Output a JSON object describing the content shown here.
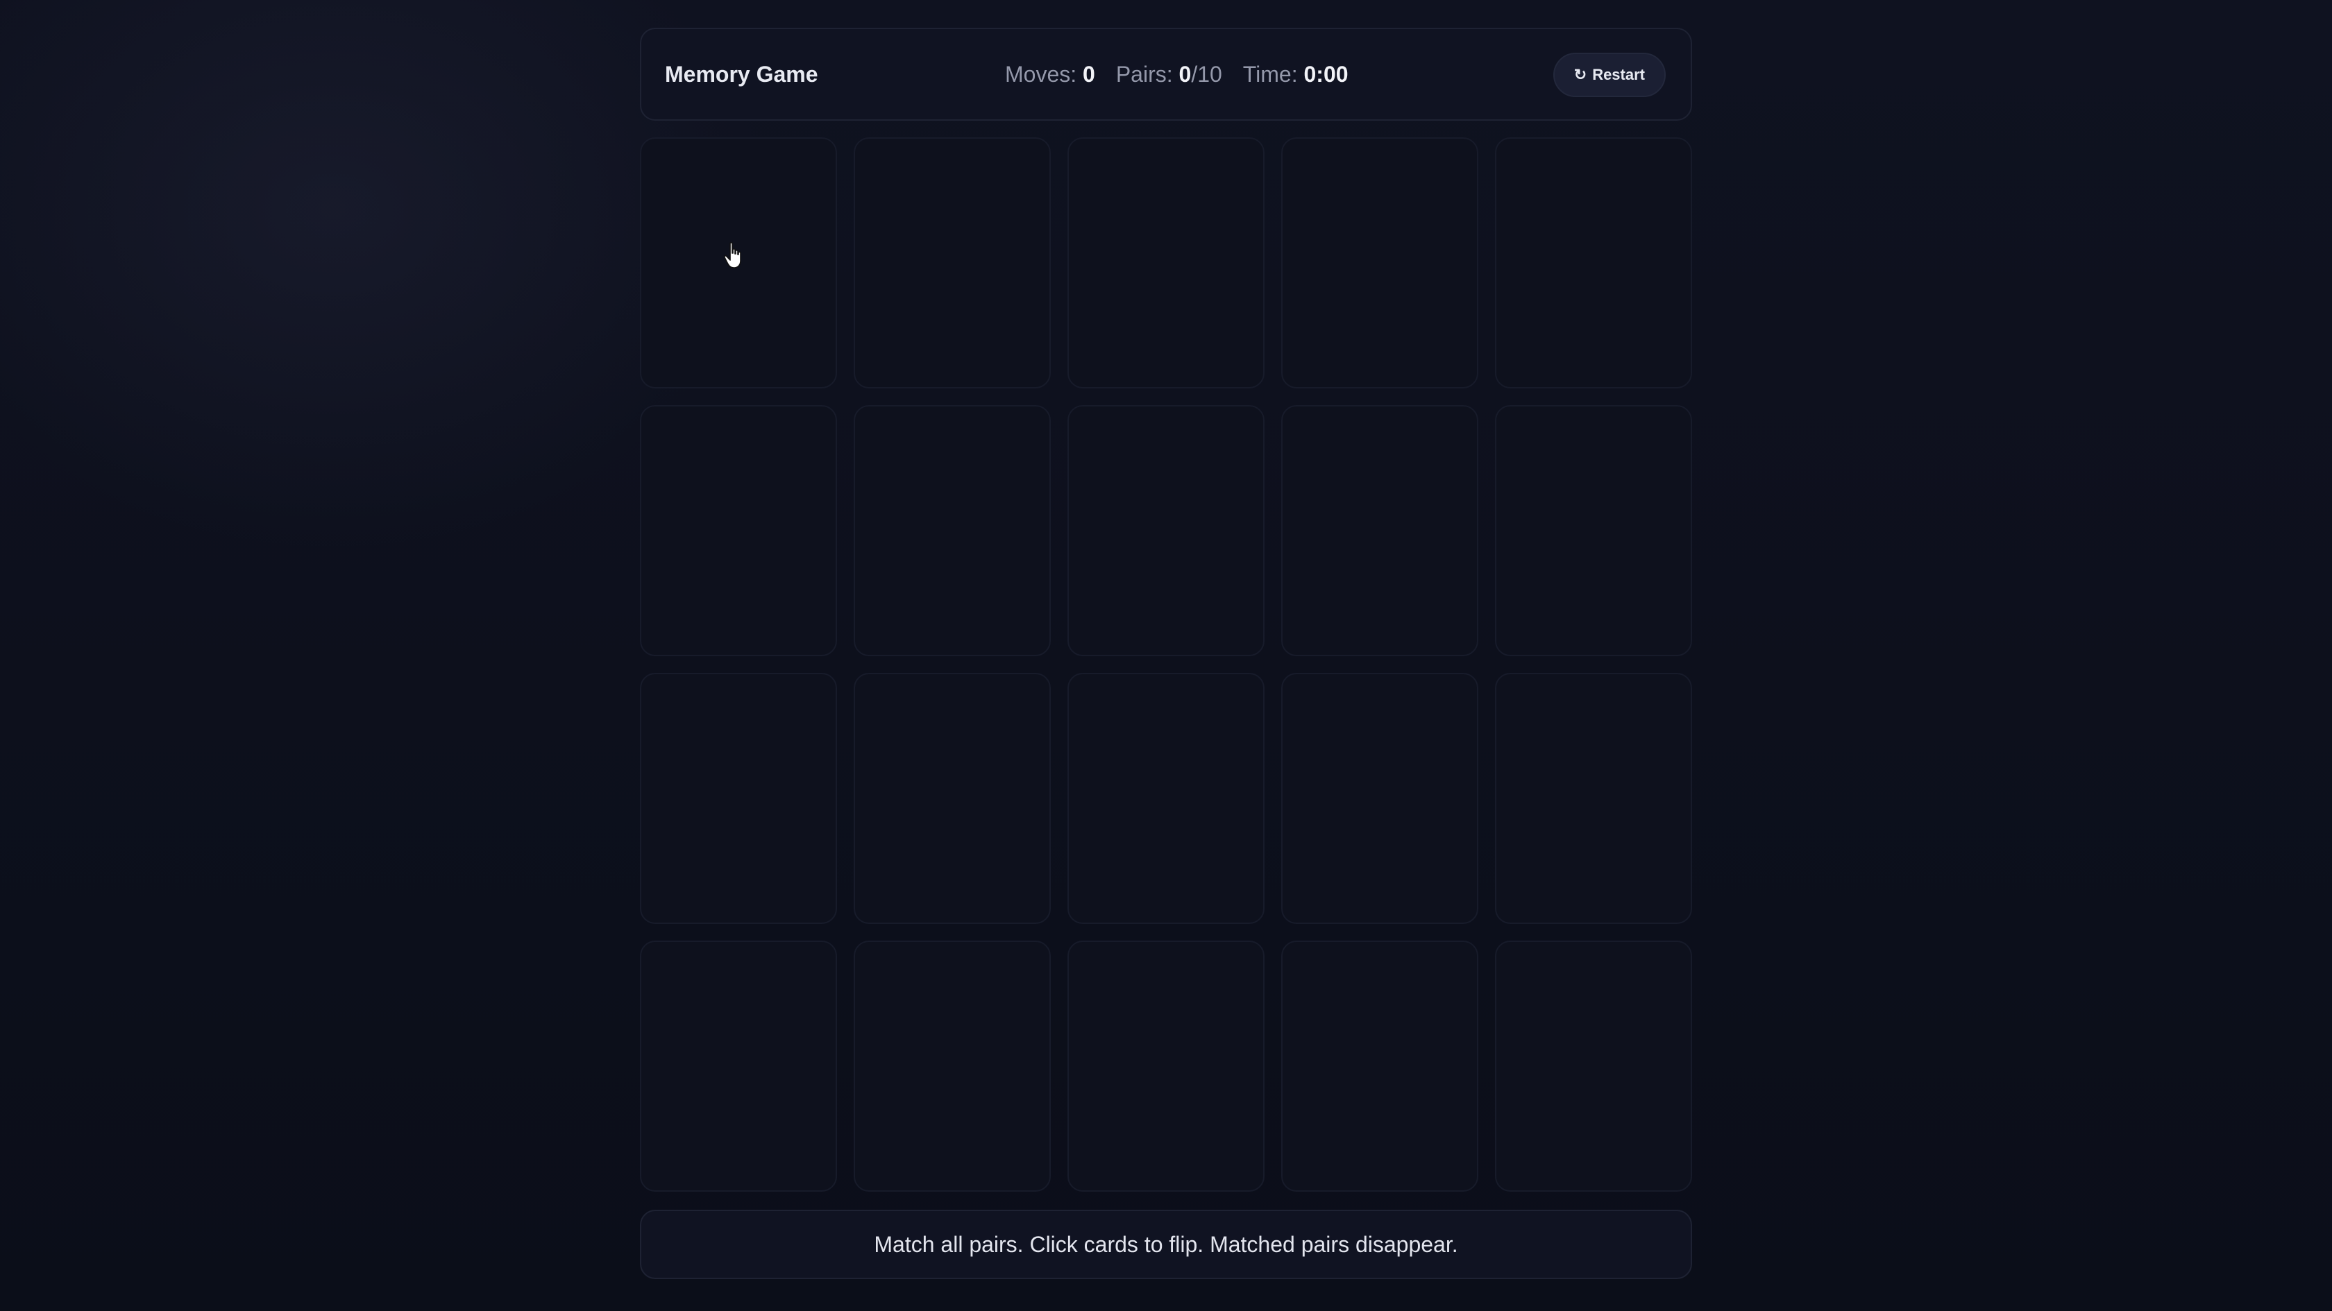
{
  "header": {
    "title": "Memory Game",
    "moves_label": "Moves:",
    "moves_value": "0",
    "pairs_label": "Pairs:",
    "pairs_value": "0",
    "pairs_total": "/10",
    "time_label": "Time:",
    "time_value": "0:00",
    "restart_label": "Restart",
    "restart_icon": "refresh-icon"
  },
  "board": {
    "rows": 4,
    "columns": 5,
    "card_count": 20,
    "face_down": true
  },
  "footer": {
    "instructions": "Match all pairs. Click cards to flip. Matched pairs disappear."
  },
  "colors": {
    "background": "#0d1020",
    "panel": "#101322",
    "card": "#0e111d",
    "accent_text": "#f2f3f8"
  }
}
